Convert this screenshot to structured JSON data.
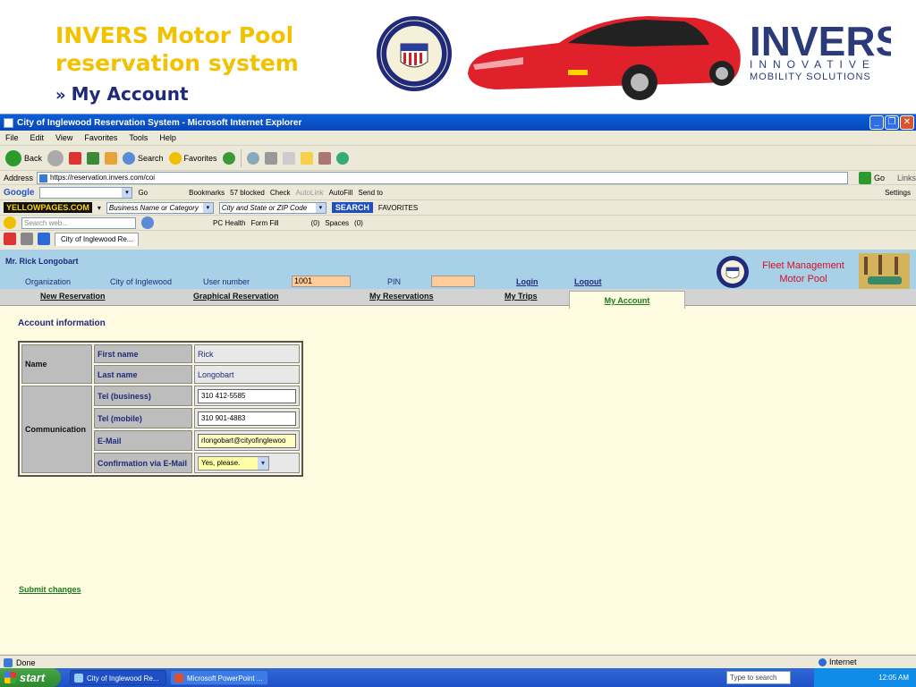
{
  "slide": {
    "title_line1": "INVERS Motor Pool",
    "title_line2": "reservation system",
    "subtitle_arrows": "»",
    "subtitle": "My Account"
  },
  "browser": {
    "title": "City of Inglewood Reservation System - Microsoft Internet Explorer",
    "menu": [
      "File",
      "Edit",
      "View",
      "Favorites",
      "Tools",
      "Help"
    ],
    "toolbar": {
      "back": "Back",
      "search": "Search",
      "favorites": "Favorites"
    },
    "address_label": "Address",
    "address_value": "https://reservation.invers.com/coi",
    "go": "Go",
    "links": "Links",
    "google": {
      "logo": "Google",
      "go": "Go",
      "bookmarks": "Bookmarks",
      "blocked": "57 blocked",
      "check": "Check",
      "autolink": "AutoLink",
      "autofill": "AutoFill",
      "sendto": "Send to",
      "settings": "Settings"
    },
    "yellowpages": {
      "logo": "YELLOWPAGES.COM",
      "business_placeholder": "Business Name or Category",
      "city_placeholder": "City and State or ZIP Code",
      "search": "SEARCH",
      "favorites": "FAVORITES"
    },
    "search_toolbar": {
      "placeholder": "Search web...",
      "pc_health": "PC Health",
      "form_fill": "Form Fill",
      "count1": "(0)",
      "spaces": "Spaces",
      "count2": "(0)"
    },
    "tab_title": "City of Inglewood Re...",
    "status": "Done",
    "status_zone": "Internet"
  },
  "page": {
    "user_name": "Mr. Rick Longobart",
    "org_label": "Organization",
    "org_value": "City of Inglewood",
    "user_number_label": "User number",
    "user_number_value": "1001",
    "pin_label": "PIN",
    "login": "Login",
    "logout": "Logout",
    "fleet_line1": "Fleet Management",
    "fleet_line2": "Motor Pool",
    "nav": {
      "new_reservation": "New Reservation",
      "graphical_reservation": "Graphical Reservation",
      "my_reservations": "My Reservations",
      "my_trips": "My Trips",
      "my_account": "My Account"
    },
    "section_title": "Account information",
    "account": {
      "name_group": "Name",
      "first_name_label": "First name",
      "first_name": "Rick",
      "last_name_label": "Last name",
      "last_name": "Longobart",
      "comm_group": "Communication",
      "tel_business_label": "Tel (business)",
      "tel_business": "310 412-5585",
      "tel_mobile_label": "Tel (mobile)",
      "tel_mobile": "310 901-4883",
      "email_label": "E-Mail",
      "email": "rlongobart@cityofinglewoo",
      "confirm_label": "Confirmation via E-Mail",
      "confirm_value": "Yes, please."
    },
    "submit": "Submit changes"
  },
  "taskbar": {
    "start": "start",
    "task1": "City of Inglewood Re...",
    "task2": "Microsoft PowerPoint ...",
    "search_placeholder": "Type to search",
    "clock": "12:05 AM"
  }
}
